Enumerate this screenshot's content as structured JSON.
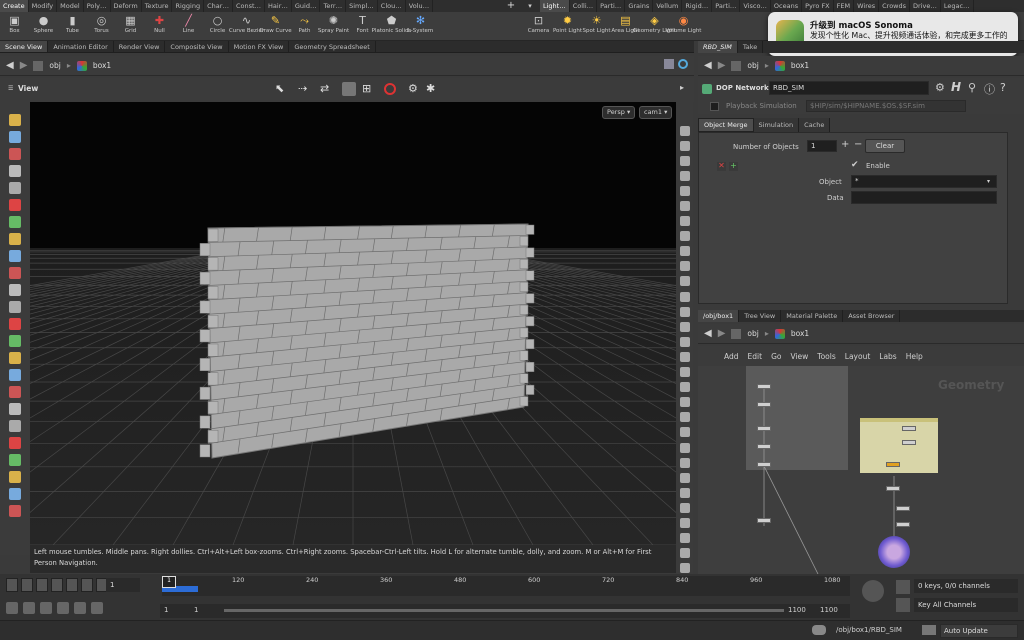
{
  "shelf": {
    "left_tabs": [
      "Create",
      "Modify",
      "Model",
      "Poly…",
      "Deform",
      "Texture",
      "Rigging",
      "Char…",
      "Const…",
      "Hair…",
      "Guid…",
      "Terr…",
      "Simpl…",
      "Clou…",
      "Volu…"
    ],
    "right_tabs": [
      "Light…",
      "Colli…",
      "Parti…",
      "Grains",
      "Vellum",
      "Rigid…",
      "Parti…",
      "Visco…",
      "Oceans",
      "Pyro FX",
      "FEM",
      "Wires",
      "Crowds",
      "Drive…",
      "Legac…"
    ],
    "left_tools": [
      {
        "label": "Box",
        "icon": "box-icon"
      },
      {
        "label": "Sphere",
        "icon": "sphere-icon"
      },
      {
        "label": "Tube",
        "icon": "tube-icon"
      },
      {
        "label": "Torus",
        "icon": "torus-icon"
      },
      {
        "label": "Grid",
        "icon": "grid-icon"
      },
      {
        "label": "Null",
        "icon": "null-icon"
      },
      {
        "label": "Line",
        "icon": "line-icon"
      },
      {
        "label": "Circle",
        "icon": "circle-icon"
      },
      {
        "label": "Curve Bezier",
        "icon": "curve-bezier-icon"
      },
      {
        "label": "Draw Curve",
        "icon": "draw-curve-icon"
      },
      {
        "label": "Path",
        "icon": "path-icon"
      },
      {
        "label": "Spray Paint",
        "icon": "spray-paint-icon"
      },
      {
        "label": "Font",
        "icon": "font-icon"
      },
      {
        "label": "Platonic Solids",
        "icon": "platonic-solids-icon"
      },
      {
        "label": "L-System",
        "icon": "l-system-icon"
      }
    ],
    "right_tools": [
      {
        "label": "Camera",
        "icon": "camera-icon"
      },
      {
        "label": "Point Light",
        "icon": "point-light-icon"
      },
      {
        "label": "Spot Light",
        "icon": "spot-light-icon"
      },
      {
        "label": "Area Light",
        "icon": "area-light-icon"
      },
      {
        "label": "Geometry Light",
        "icon": "geometry-light-icon"
      },
      {
        "label": "Volume Light",
        "icon": "volume-light-icon"
      }
    ]
  },
  "notification": {
    "title": "升级到 macOS Sonoma",
    "body": "发现个性化 Mac、提升视频通话体验，和完成更多工作的全新方式。"
  },
  "left_pane": {
    "tabs": [
      "Scene View",
      "Animation Editor",
      "Render View",
      "Composite View",
      "Motion FX View",
      "Geometry Spreadsheet"
    ],
    "path_root": "obj",
    "path_node": "box1",
    "view_label": "View",
    "persp": "Persp",
    "camera": "cam1",
    "hint": "Left mouse tumbles. Middle pans. Right dollies. Ctrl+Alt+Left box-zooms. Ctrl+Right zooms. Spacebar-Ctrl-Left tilts. Hold L for alternate tumble, dolly, and zoom.    M or Alt+M for First Person Navigation."
  },
  "param_pane": {
    "tabs": [
      "RBD_SIM",
      "Take"
    ],
    "path_root": "obj",
    "path_node": "box1",
    "node_type": "DOP Network",
    "node_name": "RBD_SIM",
    "playback_label": "Playback Simulation",
    "sim_path": "$HIP/sim/$HIPNAME.$OS.$SF.sim",
    "subtabs": [
      "Object Merge",
      "Simulation",
      "Cache"
    ],
    "num_objects_label": "Number of Objects",
    "num_objects": "1",
    "clear_label": "Clear",
    "enable_label": "Enable",
    "object_label": "Object",
    "object_value": "*",
    "data_label": "Data",
    "data_value": ""
  },
  "network_pane": {
    "tabs": [
      "/obj/box1",
      "Tree View",
      "Material Palette",
      "Asset Browser"
    ],
    "path_root": "obj",
    "path_node": "box1",
    "menu": [
      "Add",
      "Edit",
      "Go",
      "View",
      "Tools",
      "Layout",
      "Labs",
      "Help"
    ],
    "context_label": "Geometry"
  },
  "timeline": {
    "current_frame": "1",
    "ticks": [
      "120",
      "240",
      "360",
      "480",
      "600",
      "720",
      "840",
      "960",
      "1080"
    ],
    "start": "1",
    "start2": "1",
    "end": "1100",
    "end2": "1100",
    "keys_info": "0 keys, 0/0 channels",
    "key_all": "Key All Channels"
  },
  "status": {
    "path": "/obj/box1/RBD_SIM",
    "update_mode": "Auto Update"
  }
}
